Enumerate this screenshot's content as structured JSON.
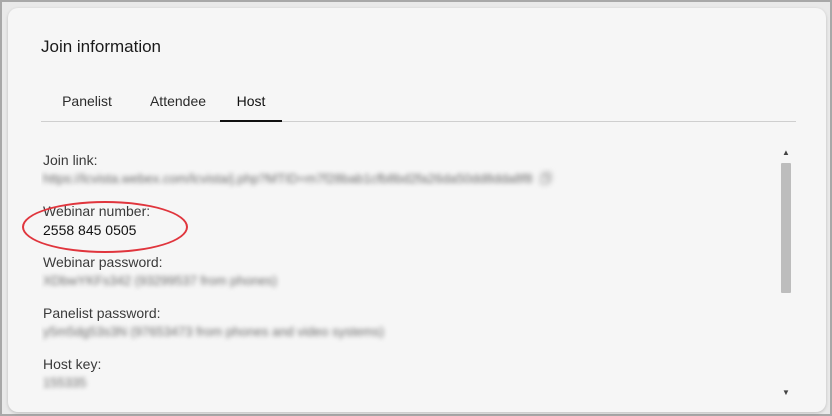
{
  "dialog": {
    "title": "Join information"
  },
  "tabs": [
    {
      "label": "Panelist",
      "active": false
    },
    {
      "label": "Attendee",
      "active": false
    },
    {
      "label": "Host",
      "active": true
    }
  ],
  "fields": {
    "join_link": {
      "label": "Join link:",
      "value": "https://lcvista.webex.com/lcvista/j.php?MTID=m7f28bab1cfb8bd2fa26da50dd8dda8f8"
    },
    "webinar_number": {
      "label": "Webinar number:",
      "value": "2558 845 0505"
    },
    "webinar_password": {
      "label": "Webinar password:",
      "value": "XDbwYKFs342 (93299537 from phones)"
    },
    "panelist_password": {
      "label": "Panelist password:",
      "value": "y5m5dg53s3N (97653473 from phones and video systems)"
    },
    "host_key": {
      "label": "Host key:",
      "value": "155335"
    }
  },
  "icons": {
    "copy": "copy-icon",
    "scroll_up": "triangle-up",
    "scroll_down": "triangle-down"
  },
  "colors": {
    "highlight_ring": "#e0353d",
    "active_tab_underline": "#111111"
  }
}
